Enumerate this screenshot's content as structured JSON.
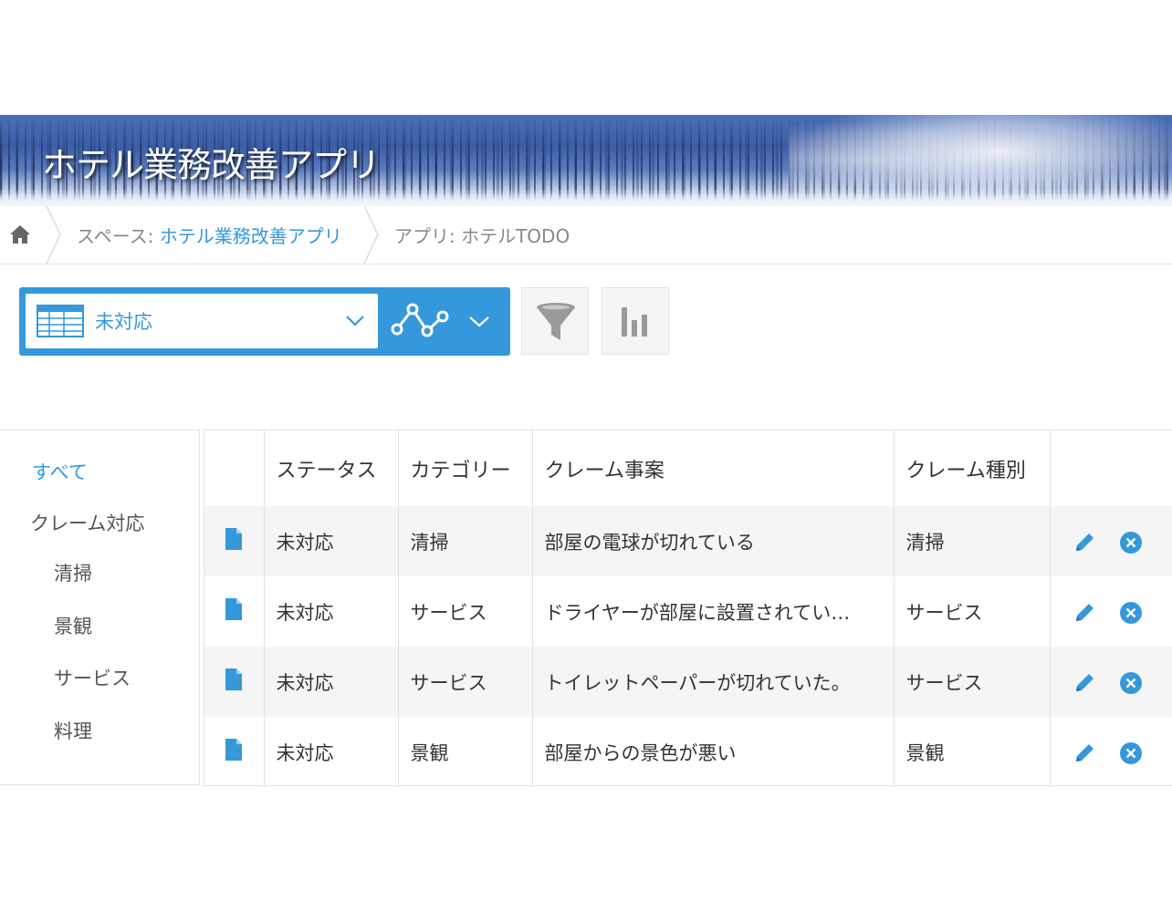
{
  "app": {
    "title": "ホテル業務改善アプリ"
  },
  "breadcrumb": {
    "home_icon": "home-icon",
    "space_prefix": "スペース: ",
    "space_name": "ホテル業務改善アプリ",
    "app_label": "アプリ: ホテルTODO"
  },
  "toolbar": {
    "view_icon": "table-view-icon",
    "view_name": "未対応",
    "graph_icon": "line-graph-icon",
    "filter_icon": "filter-icon",
    "chart_icon": "bar-chart-icon",
    "accent_color": "#3498db"
  },
  "sidebar": {
    "items": [
      {
        "label": "すべて",
        "active": true,
        "level": 0
      },
      {
        "label": "クレーム対応",
        "active": false,
        "level": 0
      },
      {
        "label": "清掃",
        "active": false,
        "level": 1
      },
      {
        "label": "景観",
        "active": false,
        "level": 1
      },
      {
        "label": "サービス",
        "active": false,
        "level": 1
      },
      {
        "label": "料理",
        "active": false,
        "level": 1
      }
    ]
  },
  "table": {
    "columns": [
      "",
      "ステータス",
      "カテゴリー",
      "クレーム事案",
      "クレーム種別",
      ""
    ],
    "rows": [
      {
        "status": "未対応",
        "category": "清掃",
        "case": "部屋の電球が切れている",
        "type": "清掃"
      },
      {
        "status": "未対応",
        "category": "サービス",
        "case": "ドライヤーが部屋に設置されてい…",
        "type": "サービス"
      },
      {
        "status": "未対応",
        "category": "サービス",
        "case": "トイレットペーパーが切れていた。",
        "type": "サービス"
      },
      {
        "status": "未対応",
        "category": "景観",
        "case": "部屋からの景色が悪い",
        "type": "景観"
      }
    ],
    "row_icons": {
      "detail": "document-icon",
      "edit": "pencil-icon",
      "delete": "close-circle-icon"
    },
    "icon_color": "#3498db"
  }
}
